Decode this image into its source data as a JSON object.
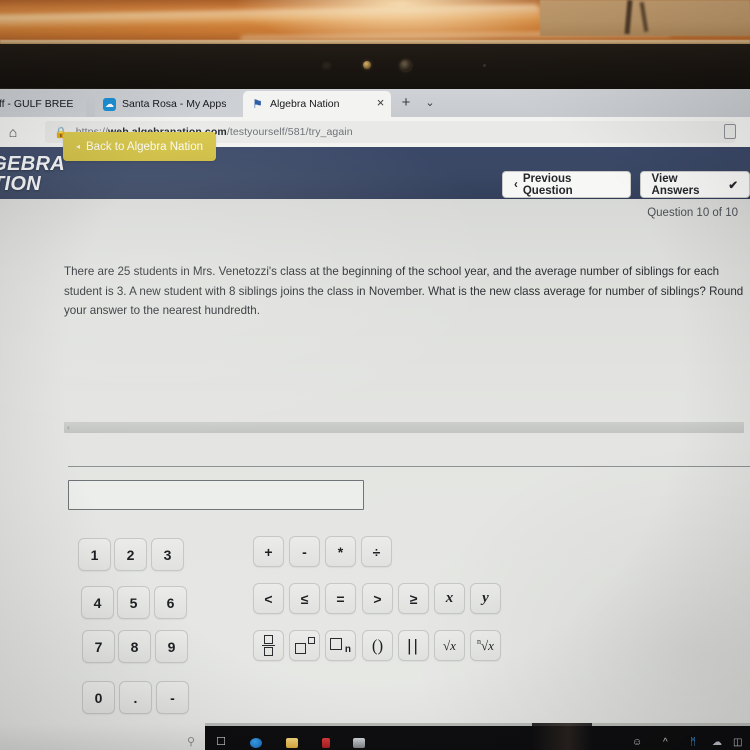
{
  "photo": {
    "description": "photo-of-laptop-screen",
    "ambient_light_color": "#e09445",
    "wall_color": "#c09a6c",
    "bezel_color": "#1b1611"
  },
  "browser": {
    "tabs": [
      {
        "label": "ts/Staff - GULF BREE",
        "favicon": "none-icon",
        "active": false
      },
      {
        "label": "Santa Rosa - My Apps",
        "favicon": "cloud-icon",
        "active": false
      },
      {
        "label": "Algebra Nation",
        "favicon": "flag-icon",
        "active": true
      }
    ],
    "tab_close_label": "×",
    "new_tab_label": "+",
    "tab_menu_label": "⌄",
    "home_icon_label": "⌂",
    "lock_icon_label": "🔒",
    "url": {
      "scheme": "https://",
      "host": "web.algebranation.com",
      "path": "/testyourself/581/try_again",
      "full": "https://web.algebranation.com/testyourself/581/try_again"
    },
    "favorite_icon": "bookmark-icon"
  },
  "site": {
    "logo_line1": "ALGEBRA",
    "logo_line2": "NATION",
    "banner_color": "#394764"
  },
  "toolbar": {
    "back_label": "Back to Algebra Nation",
    "back_chevron": "◂",
    "back_color": "#d3c248",
    "previous_label": "Previous Question",
    "previous_chevron": "‹",
    "view_answers_label": "View Answers",
    "view_answers_check": "✔",
    "question_counter": "Question 10 of 10"
  },
  "question": {
    "text": "There are 25 students in Mrs. Venetozzi's class at the beginning of the school year, and the average number of siblings for each student is 3. A new student with 8 siblings joins the class in November. What is the new class average for number of siblings? Round your answer to the nearest hundredth.",
    "scroll_chevron": "‹"
  },
  "answer": {
    "value": "",
    "placeholder": ""
  },
  "keypad": {
    "numbers": [
      "1",
      "2",
      "3",
      "4",
      "5",
      "6",
      "7",
      "8",
      "9",
      "0",
      ".",
      "-"
    ],
    "operators": [
      "+",
      "-",
      "*",
      "÷"
    ],
    "comparisons": [
      "<",
      "≤",
      "=",
      ">",
      "≥"
    ],
    "variables": [
      "x",
      "y"
    ],
    "templates": [
      {
        "name": "fraction",
        "label": "□/□"
      },
      {
        "name": "exponent",
        "label": "□^□"
      },
      {
        "name": "subscript",
        "label": "□n"
      },
      {
        "name": "parentheses",
        "label": "()"
      },
      {
        "name": "absolute-value",
        "label": "||"
      },
      {
        "name": "square-root",
        "label": "√x"
      },
      {
        "name": "nth-root",
        "label": "ⁿ√x"
      }
    ]
  },
  "taskbar": {
    "icons": [
      "search-icon",
      "task-view-icon",
      "edge-icon",
      "file-explorer-icon",
      "red-app-icon",
      "dark-app-icon"
    ],
    "tray": [
      "people-icon",
      "show-hidden-icons-chevron",
      "bluetooth-icon",
      "weather-cloud-icon",
      "battery-icon"
    ],
    "tray_glyphs": [
      "⚬",
      "⌃",
      "ᛗ",
      "☁",
      "▭"
    ]
  }
}
